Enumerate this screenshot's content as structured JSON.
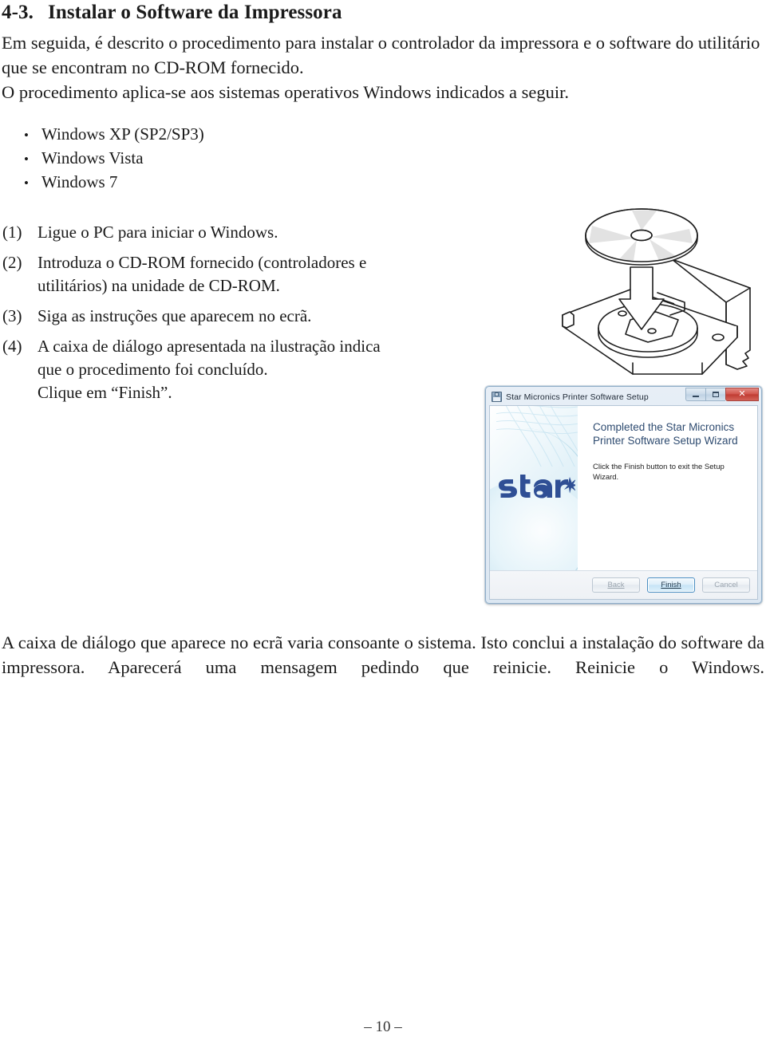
{
  "heading": {
    "number": "4-3.",
    "title": "Instalar o Software da Impressora"
  },
  "intro": {
    "line1": "Em seguida, é descrito o procedimento para instalar o controlador da impressora e o software do utilitário que se encontram no CD-ROM fornecido.",
    "line2": "O procedimento aplica-se aos sistemas operativos Windows indicados a seguir."
  },
  "bullets": {
    "marker": "•",
    "items": [
      "Windows XP (SP2/SP3)",
      "Windows Vista",
      "Windows 7"
    ]
  },
  "steps": [
    {
      "number": "(1)",
      "lines": [
        "Ligue o PC para iniciar o Windows."
      ]
    },
    {
      "number": "(2)",
      "lines": [
        "Introduza o CD-ROM fornecido (controladores e",
        "utilitários) na unidade de CD-ROM."
      ]
    },
    {
      "number": "(3)",
      "lines": [
        "Siga as instruções que aparecem no ecrã."
      ]
    },
    {
      "number": "(4)",
      "lines": [
        "A caixa de diálogo apresentada na ilustração indica",
        "que o procedimento foi concluído.",
        "Clique em “Finish”."
      ]
    }
  ],
  "closing": "A caixa de diálogo que aparece no ecrã varia consoante o sistema. Isto conclui a instalação do software da impressora. Aparecerá uma mensagem pedindo que reinicie. Reinicie o Windows.",
  "page_number": "– 10 –",
  "illustration": {
    "name": "cd-rom-insertion-illustration",
    "description": "CD being inserted into an open CD-ROM drive tray"
  },
  "dialog": {
    "title": "Star Micronics Printer Software Setup",
    "icon": "installer-disk-icon",
    "window_buttons": {
      "minimize": "—",
      "maximize": "▢",
      "close": "✕"
    },
    "heading": "Completed the Star Micronics Printer Software Setup Wizard",
    "body": "Click the Finish button to exit the Setup Wizard.",
    "brand": "star",
    "buttons": {
      "back": "Back",
      "finish": "Finish",
      "cancel": "Cancel"
    },
    "colors": {
      "brand_blue": "#2f4f95",
      "title_text": "#2e4b70",
      "close_red": "#bf3a31",
      "primary_border": "#4a8ec2"
    }
  }
}
